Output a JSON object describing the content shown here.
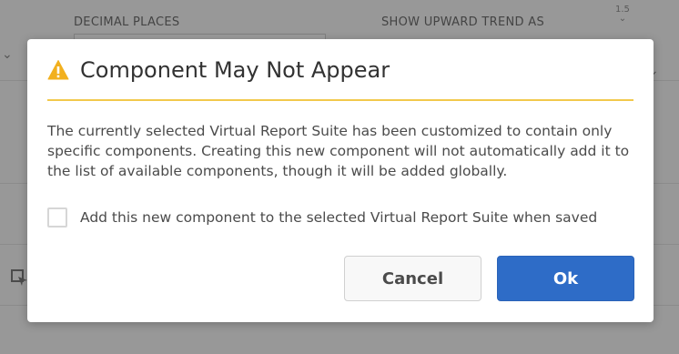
{
  "background": {
    "decimal_places_label": "DECIMAL PLACES",
    "show_upward_trend_label": "SHOW UPWARD TREND AS",
    "spinner_value": "1.5"
  },
  "dialog": {
    "title": "Component May Not Appear",
    "icon": "warning-icon",
    "accent_color": "#f2c94c",
    "message": "The currently selected Virtual Report Suite has been customized to contain only specific components. Creating this new component will not automatically add it to the list of available components, though it will be added globally.",
    "checkbox": {
      "label": "Add this new component to the selected Virtual Report Suite when saved",
      "checked": false
    },
    "buttons": {
      "cancel_label": "Cancel",
      "ok_label": "Ok",
      "ok_color": "#2e6cc7"
    }
  }
}
